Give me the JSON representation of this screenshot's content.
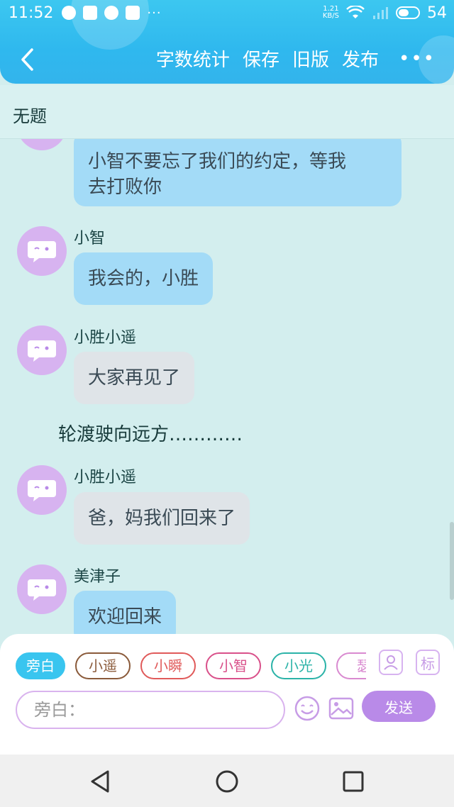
{
  "status_bar": {
    "time": "11:52",
    "net_speed_value": "1.21",
    "net_speed_unit": "KB/S",
    "battery": "54",
    "battery_level": 0.54
  },
  "header": {
    "actions": [
      "字数统计",
      "保存",
      "旧版",
      "发布"
    ],
    "more": "•••"
  },
  "title": "无题",
  "messages": [
    {
      "type": "bubble",
      "name": "",
      "text_lines": [
        "小智不要忘了我们的约定，等我",
        "去打败你"
      ],
      "style": "blue"
    },
    {
      "type": "bubble",
      "name": "小智",
      "text_lines": [
        "我会的，小胜"
      ],
      "style": "blue"
    },
    {
      "type": "bubble",
      "name": "小胜小遥",
      "text_lines": [
        "大家再见了"
      ],
      "style": "gray"
    },
    {
      "type": "narration",
      "text": "轮渡驶向远方…………"
    },
    {
      "type": "bubble",
      "name": "小胜小遥",
      "text_lines": [
        "爸，妈我们回来了"
      ],
      "style": "gray"
    },
    {
      "type": "bubble",
      "name": "美津子",
      "text_lines": [
        "欢迎回来"
      ],
      "style": "blue"
    }
  ],
  "composer": {
    "chips": [
      {
        "label": "旁白",
        "color": "#39c5ef",
        "active": true
      },
      {
        "label": "小遥",
        "color": "#8a5a3a",
        "active": false
      },
      {
        "label": "小瞬",
        "color": "#e05a5a",
        "active": false
      },
      {
        "label": "小智",
        "color": "#d9508a",
        "active": false
      },
      {
        "label": "小光",
        "color": "#2bb3a8",
        "active": false
      },
      {
        "label": "瑟",
        "color": "#d98ad0",
        "active": false
      }
    ],
    "role_icon": "person-card-icon",
    "tag_label": "标",
    "input_placeholder": "旁白：",
    "send_label": "发送"
  },
  "colors": {
    "header": "#33b4ec",
    "background": "#d3eeee",
    "bubble_blue": "#a3dbf7",
    "bubble_gray": "#dfe4e8",
    "avatar": "#d7b3f0",
    "send": "#b98ae8"
  }
}
